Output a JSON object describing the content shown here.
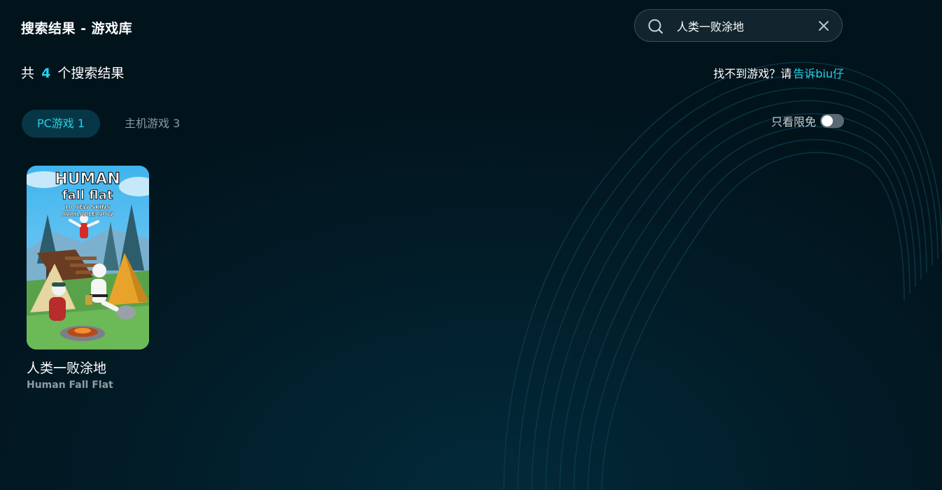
{
  "header": {
    "title": "搜索结果 - 游戏库"
  },
  "search": {
    "value": "人类一败涂地",
    "icon": "search-icon",
    "clear_icon": "close-icon"
  },
  "summary": {
    "prefix": "共",
    "count": "4",
    "suffix": "个搜索结果"
  },
  "feedback": {
    "text": "找不到游戏？请",
    "link": "告诉biu仔"
  },
  "tabs": [
    {
      "label": "PC游戏 1",
      "active": true
    },
    {
      "label": "主机游戏 3",
      "active": false
    }
  ],
  "filter": {
    "label": "只看限免",
    "enabled": false
  },
  "games": [
    {
      "name": "人类一败涂地",
      "name_en": "Human Fall Flat",
      "cover_text": {
        "line1": "HUMAN",
        "line2": "fall flat",
        "line3": "10 NEW SKINS",
        "line4": "AVAILABLE NOW"
      }
    }
  ],
  "colors": {
    "accent": "#22d3e6",
    "background": "#021c28",
    "tab_active_bg": "#073746",
    "muted_text": "#8a9aa3"
  }
}
